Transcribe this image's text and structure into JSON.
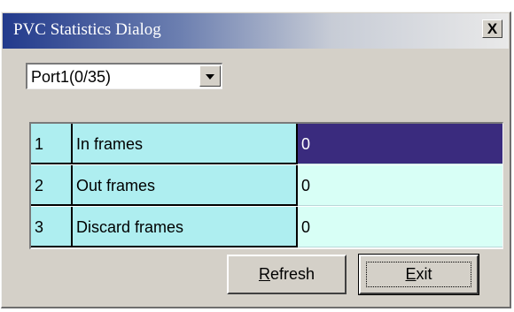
{
  "window": {
    "title": "PVC Statistics Dialog",
    "close_glyph": "X"
  },
  "port_select": {
    "selected": "Port1(0/35)"
  },
  "stats_table": {
    "rows": [
      {
        "index": "1",
        "name": "In frames",
        "value": "0",
        "selected": true
      },
      {
        "index": "2",
        "name": "Out frames",
        "value": "0",
        "selected": false
      },
      {
        "index": "3",
        "name": "Discard frames",
        "value": "0",
        "selected": false
      }
    ]
  },
  "buttons": {
    "refresh": {
      "accel": "R",
      "rest": "efresh"
    },
    "exit": {
      "accel": "E",
      "rest": "xit"
    }
  }
}
